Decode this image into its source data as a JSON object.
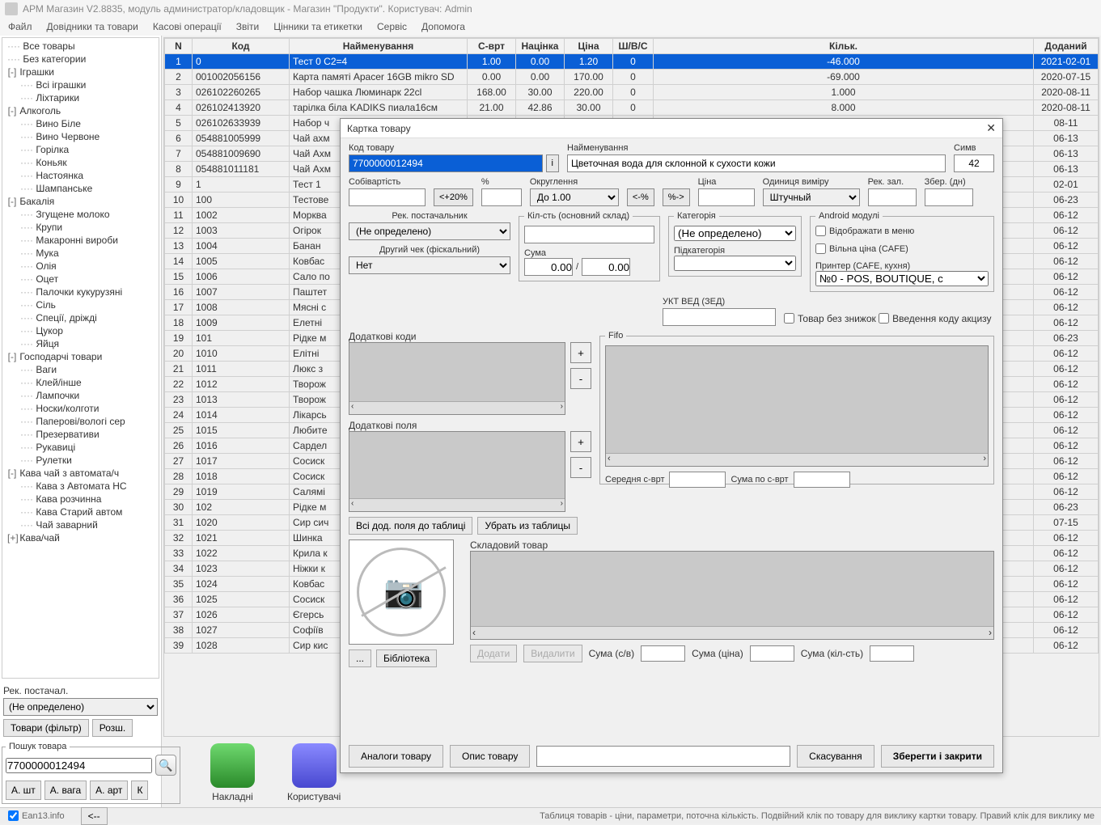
{
  "window": {
    "title": "АРМ Магазин V2.8835, модуль администратор/кладовщик - Магазин \"Продукти\". Користувач: Admin"
  },
  "menu": [
    "Файл",
    "Довідники та товари",
    "Касові операції",
    "Звіти",
    "Цінники та етикетки",
    "Сервіс",
    "Допомога"
  ],
  "tree": [
    {
      "t": "Все товары",
      "lvl": 0,
      "exp": ""
    },
    {
      "t": "Без категории",
      "lvl": 0,
      "exp": ""
    },
    {
      "t": "Іграшки",
      "lvl": 0,
      "exp": "-"
    },
    {
      "t": "Всі іграшки",
      "lvl": 1,
      "exp": ""
    },
    {
      "t": "Ліхтарики",
      "lvl": 1,
      "exp": ""
    },
    {
      "t": "Алкоголь",
      "lvl": 0,
      "exp": "-"
    },
    {
      "t": "Вино Біле",
      "lvl": 1,
      "exp": ""
    },
    {
      "t": "Вино Червоне",
      "lvl": 1,
      "exp": ""
    },
    {
      "t": "Горілка",
      "lvl": 1,
      "exp": ""
    },
    {
      "t": "Коньяк",
      "lvl": 1,
      "exp": ""
    },
    {
      "t": "Настоянка",
      "lvl": 1,
      "exp": ""
    },
    {
      "t": "Шампанське",
      "lvl": 1,
      "exp": ""
    },
    {
      "t": "Бакалія",
      "lvl": 0,
      "exp": "-"
    },
    {
      "t": "Згущене молоко",
      "lvl": 1,
      "exp": ""
    },
    {
      "t": "Крупи",
      "lvl": 1,
      "exp": ""
    },
    {
      "t": "Макаронні вироби",
      "lvl": 1,
      "exp": ""
    },
    {
      "t": "Мука",
      "lvl": 1,
      "exp": ""
    },
    {
      "t": "Олія",
      "lvl": 1,
      "exp": ""
    },
    {
      "t": "Оцет",
      "lvl": 1,
      "exp": ""
    },
    {
      "t": "Палочки кукурузяні",
      "lvl": 1,
      "exp": ""
    },
    {
      "t": "Сіль",
      "lvl": 1,
      "exp": ""
    },
    {
      "t": "Спеції, дріжді",
      "lvl": 1,
      "exp": ""
    },
    {
      "t": "Цукор",
      "lvl": 1,
      "exp": ""
    },
    {
      "t": "Яйця",
      "lvl": 1,
      "exp": ""
    },
    {
      "t": "Господарчі товари",
      "lvl": 0,
      "exp": "-"
    },
    {
      "t": "Ваги",
      "lvl": 1,
      "exp": ""
    },
    {
      "t": "Клей/інше",
      "lvl": 1,
      "exp": ""
    },
    {
      "t": "Лампочки",
      "lvl": 1,
      "exp": ""
    },
    {
      "t": "Носки/колготи",
      "lvl": 1,
      "exp": ""
    },
    {
      "t": "Паперові/вологі сер",
      "lvl": 1,
      "exp": ""
    },
    {
      "t": "Презервативи",
      "lvl": 1,
      "exp": ""
    },
    {
      "t": "Рукавиці",
      "lvl": 1,
      "exp": ""
    },
    {
      "t": "Рулетки",
      "lvl": 1,
      "exp": ""
    },
    {
      "t": "Кава  чай з автомата/ч",
      "lvl": 0,
      "exp": "-"
    },
    {
      "t": "Кава з Автомата НС",
      "lvl": 1,
      "exp": ""
    },
    {
      "t": "Кава розчинна",
      "lvl": 1,
      "exp": ""
    },
    {
      "t": "Кава Старий автом",
      "lvl": 1,
      "exp": ""
    },
    {
      "t": "Чай заварний",
      "lvl": 1,
      "exp": ""
    },
    {
      "t": "Кава/чай",
      "lvl": 0,
      "exp": "+"
    }
  ],
  "side": {
    "rec_label": "Рек. постачал.",
    "rec_value": "(Не определено)",
    "filter_btn": "Товари (фільтр)",
    "ext_btn": "Розш.",
    "search_group": "Пошук товара",
    "search_value": "7700000012494",
    "btn_asht": "А. шт",
    "btn_avaga": "А. вага",
    "btn_aart": "А. арт",
    "btn_k": "К"
  },
  "iconsbar": {
    "nakladni": "Накладні",
    "users": "Користувачі"
  },
  "columns": [
    "N",
    "Код",
    "Найменування",
    "С-врт",
    "Націнка",
    "Ціна",
    "Ш/В/С",
    "Кільк.",
    "Доданий"
  ],
  "rows": [
    {
      "n": 1,
      "code": "0",
      "name": "Тест 0 С2=4",
      "cv": "1.00",
      "m": "0.00",
      "p": "1.20",
      "s": "0",
      "q": "-46.000",
      "d": "2021-02-01",
      "sel": true
    },
    {
      "n": 2,
      "code": "001002056156",
      "name": "Карта памяті Apacer 16GB mikro SD",
      "cv": "0.00",
      "m": "0.00",
      "p": "170.00",
      "s": "0",
      "q": "-69.000",
      "d": "2020-07-15"
    },
    {
      "n": 3,
      "code": "026102260265",
      "name": "Набор чашка Люминарк 22cl",
      "cv": "168.00",
      "m": "30.00",
      "p": "220.00",
      "s": "0",
      "q": "1.000",
      "d": "2020-08-11"
    },
    {
      "n": 4,
      "code": "026102413920",
      "name": "тарілка біла KADIKS пиала16см",
      "cv": "21.00",
      "m": "42.86",
      "p": "30.00",
      "s": "0",
      "q": "8.000",
      "d": "2020-08-11"
    },
    {
      "n": 5,
      "code": "026102633939",
      "name": "Набор ч",
      "cv": "",
      "m": "",
      "p": "",
      "s": "",
      "q": "",
      "d": "08-11"
    },
    {
      "n": 6,
      "code": "054881005999",
      "name": "Чай ахм",
      "cv": "",
      "m": "",
      "p": "",
      "s": "",
      "q": "",
      "d": "06-13"
    },
    {
      "n": 7,
      "code": "054881009690",
      "name": "Чай Ахм",
      "cv": "",
      "m": "",
      "p": "",
      "s": "",
      "q": "",
      "d": "06-13"
    },
    {
      "n": 8,
      "code": "054881011181",
      "name": "Чай Ахм",
      "cv": "",
      "m": "",
      "p": "",
      "s": "",
      "q": "",
      "d": "06-13"
    },
    {
      "n": 9,
      "code": "1",
      "name": "Тест 1",
      "cv": "",
      "m": "",
      "p": "",
      "s": "",
      "q": "",
      "d": "02-01"
    },
    {
      "n": 10,
      "code": "100",
      "name": "Тестове",
      "cv": "",
      "m": "",
      "p": "",
      "s": "",
      "q": "",
      "d": "06-23"
    },
    {
      "n": 11,
      "code": "1002",
      "name": "Морква",
      "cv": "",
      "m": "",
      "p": "",
      "s": "",
      "q": "",
      "d": "06-12"
    },
    {
      "n": 12,
      "code": "1003",
      "name": "Огірок",
      "cv": "",
      "m": "",
      "p": "",
      "s": "",
      "q": "",
      "d": "06-12"
    },
    {
      "n": 13,
      "code": "1004",
      "name": "Банан",
      "cv": "",
      "m": "",
      "p": "",
      "s": "",
      "q": "",
      "d": "06-12"
    },
    {
      "n": 14,
      "code": "1005",
      "name": "Ковбас",
      "cv": "",
      "m": "",
      "p": "",
      "s": "",
      "q": "",
      "d": "06-12"
    },
    {
      "n": 15,
      "code": "1006",
      "name": "Сало по",
      "cv": "",
      "m": "",
      "p": "",
      "s": "",
      "q": "",
      "d": "06-12"
    },
    {
      "n": 16,
      "code": "1007",
      "name": "Паштет",
      "cv": "",
      "m": "",
      "p": "",
      "s": "",
      "q": "",
      "d": "06-12"
    },
    {
      "n": 17,
      "code": "1008",
      "name": "Мясні с",
      "cv": "",
      "m": "",
      "p": "",
      "s": "",
      "q": "",
      "d": "06-12"
    },
    {
      "n": 18,
      "code": "1009",
      "name": "Елетні",
      "cv": "",
      "m": "",
      "p": "",
      "s": "",
      "q": "",
      "d": "06-12"
    },
    {
      "n": 19,
      "code": "101",
      "name": "Рідке м",
      "cv": "",
      "m": "",
      "p": "",
      "s": "",
      "q": "",
      "d": "06-23"
    },
    {
      "n": 20,
      "code": "1010",
      "name": "Елітні",
      "cv": "",
      "m": "",
      "p": "",
      "s": "",
      "q": "",
      "d": "06-12"
    },
    {
      "n": 21,
      "code": "1011",
      "name": "Люкс з",
      "cv": "",
      "m": "",
      "p": "",
      "s": "",
      "q": "",
      "d": "06-12"
    },
    {
      "n": 22,
      "code": "1012",
      "name": "Творож",
      "cv": "",
      "m": "",
      "p": "",
      "s": "",
      "q": "",
      "d": "06-12"
    },
    {
      "n": 23,
      "code": "1013",
      "name": "Творож",
      "cv": "",
      "m": "",
      "p": "",
      "s": "",
      "q": "",
      "d": "06-12"
    },
    {
      "n": 24,
      "code": "1014",
      "name": "Лікарсь",
      "cv": "",
      "m": "",
      "p": "",
      "s": "",
      "q": "",
      "d": "06-12"
    },
    {
      "n": 25,
      "code": "1015",
      "name": "Любите",
      "cv": "",
      "m": "",
      "p": "",
      "s": "",
      "q": "",
      "d": "06-12"
    },
    {
      "n": 26,
      "code": "1016",
      "name": "Сардел",
      "cv": "",
      "m": "",
      "p": "",
      "s": "",
      "q": "",
      "d": "06-12"
    },
    {
      "n": 27,
      "code": "1017",
      "name": "Сосиск",
      "cv": "",
      "m": "",
      "p": "",
      "s": "",
      "q": "",
      "d": "06-12"
    },
    {
      "n": 28,
      "code": "1018",
      "name": "Сосиск",
      "cv": "",
      "m": "",
      "p": "",
      "s": "",
      "q": "",
      "d": "06-12"
    },
    {
      "n": 29,
      "code": "1019",
      "name": "Салямі",
      "cv": "",
      "m": "",
      "p": "",
      "s": "",
      "q": "",
      "d": "06-12"
    },
    {
      "n": 30,
      "code": "102",
      "name": "Рідке м",
      "cv": "",
      "m": "",
      "p": "",
      "s": "",
      "q": "",
      "d": "06-23"
    },
    {
      "n": 31,
      "code": "1020",
      "name": "Сир сич",
      "cv": "",
      "m": "",
      "p": "",
      "s": "",
      "q": "",
      "d": "07-15"
    },
    {
      "n": 32,
      "code": "1021",
      "name": "Шинка",
      "cv": "",
      "m": "",
      "p": "",
      "s": "",
      "q": "",
      "d": "06-12"
    },
    {
      "n": 33,
      "code": "1022",
      "name": "Крила к",
      "cv": "",
      "m": "",
      "p": "",
      "s": "",
      "q": "",
      "d": "06-12"
    },
    {
      "n": 34,
      "code": "1023",
      "name": "Ніжки к",
      "cv": "",
      "m": "",
      "p": "",
      "s": "",
      "q": "",
      "d": "06-12"
    },
    {
      "n": 35,
      "code": "1024",
      "name": "Ковбас",
      "cv": "",
      "m": "",
      "p": "",
      "s": "",
      "q": "",
      "d": "06-12"
    },
    {
      "n": 36,
      "code": "1025",
      "name": "Сосиск",
      "cv": "",
      "m": "",
      "p": "",
      "s": "",
      "q": "",
      "d": "06-12"
    },
    {
      "n": 37,
      "code": "1026",
      "name": "Єгерсь",
      "cv": "",
      "m": "",
      "p": "",
      "s": "",
      "q": "",
      "d": "06-12"
    },
    {
      "n": 38,
      "code": "1027",
      "name": "Софіїв",
      "cv": "",
      "m": "",
      "p": "",
      "s": "",
      "q": "",
      "d": "06-12"
    },
    {
      "n": 39,
      "code": "1028",
      "name": "Сир кис",
      "cv": "",
      "m": "",
      "p": "",
      "s": "",
      "q": "",
      "d": "06-12"
    }
  ],
  "status": {
    "ean": "Ean13.info",
    "back": "<--",
    "hint": "Таблиця товарів - ціни, параметри, поточна кількість. Подвійний клік по товару для виклику картки товару. Правий клік для виклику ме"
  },
  "dialog": {
    "title": "Картка товару",
    "code_label": "Код товару",
    "code_value": "7700000012494",
    "info_btn": "i",
    "name_label": "Найменування",
    "name_value": "Цветочная вода для склонной к сухости кожи",
    "symv_label": "Симв",
    "symv_value": "42",
    "cost_label": "Собівартість",
    "pct_label": "%",
    "pct_btn": "<+20%",
    "round_label": "Округлення",
    "round_value": "До 1.00",
    "pct_back": "<-%",
    "pct_fwd": "%->",
    "price_label": "Ціна",
    "unit_label": "Одиниця виміру",
    "unit_value": "Штучный",
    "rec_zal": "Рек. зал.",
    "zber": "Збер. (дн)",
    "rec_post": "Рек. постачальник",
    "rec_post_v": "(Не определено)",
    "second_check": "Другий чек (фіскальний)",
    "second_check_v": "Нет",
    "qty_group": "Кіл-сть (основний склад)",
    "sum_label": "Сума",
    "sum_v1": "0.00",
    "sum_sep": "/",
    "sum_v2": "0.00",
    "cat_group": "Категорія",
    "cat_v": "(Не определено)",
    "subcat": "Підкатегорія",
    "android_group": "Android модулі",
    "chk_menu": "Відображати в меню",
    "chk_freeprice": "Вільна ціна (CAFE)",
    "printer_label": "Принтер (CAFE, кухня)",
    "printer_v": "№0 - POS, BOUTIQUE, с",
    "ukt": "УКТ ВЕД (ЗЕД)",
    "chk_nodisc": "Товар без знижок",
    "chk_excise": "Введення коду акцизу",
    "addcodes": "Додаткові коди",
    "addfields": "Додаткові поля",
    "btn_all_fields": "Всі дод. поля до таблиці",
    "btn_remove_fields": "Убрать из таблицы",
    "fifo": "Fifo",
    "avg_cost": "Середня с-врт",
    "sum_cost": "Сума по с-врт",
    "skl": "Складовий товар",
    "btn_dots": "...",
    "btn_lib": "Бібліотека",
    "btn_add": "Додати",
    "btn_del": "Видалити",
    "sum_cv": "Сума (с/в)",
    "sum_price": "Сума (ціна)",
    "sum_qty": "Сума (кіл-сть)",
    "btn_analog": "Аналоги товару",
    "btn_desc": "Опис товару",
    "btn_cancel": "Скасування",
    "btn_save": "Зберегти і закрити"
  }
}
